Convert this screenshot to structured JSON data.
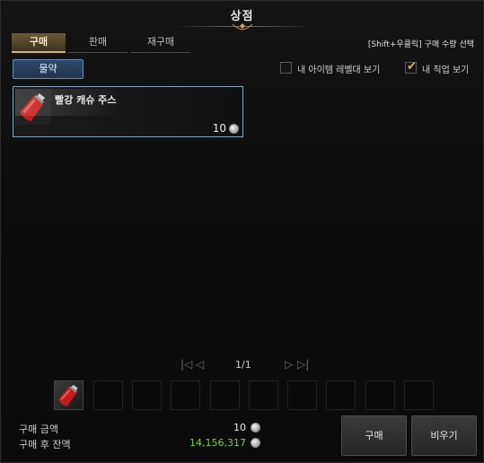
{
  "window": {
    "title": "상점"
  },
  "tabs": [
    {
      "label": "구매",
      "active": true
    },
    {
      "label": "판매",
      "active": false
    },
    {
      "label": "재구매",
      "active": false
    }
  ],
  "shift_hint": "[Shift+우클릭] 구매 수량 선택",
  "category": {
    "label": "물약"
  },
  "filters": [
    {
      "label": "내 아이템 레벨대 보기",
      "checked": false
    },
    {
      "label": "내 직업 보기",
      "checked": true
    }
  ],
  "items": [
    {
      "name": "빨강 캐슈 주스",
      "price": "10",
      "icon": "red-potion-icon"
    }
  ],
  "pagination": {
    "current": "1/1"
  },
  "cart": {
    "slot_count": 10,
    "filled_icon": "red-potion-icon"
  },
  "summary": {
    "purchase_label": "구매 금액",
    "purchase_value": "10",
    "balance_label": "구매 후 잔액",
    "balance_value": "14,156,317"
  },
  "buttons": {
    "buy": "구매",
    "clear": "비우기"
  },
  "colors": {
    "accent_gold": "#d4b56a",
    "selected_border": "#8aa4c0",
    "balance_green": "#77d14a",
    "category_blue": "#2d4a6a"
  }
}
